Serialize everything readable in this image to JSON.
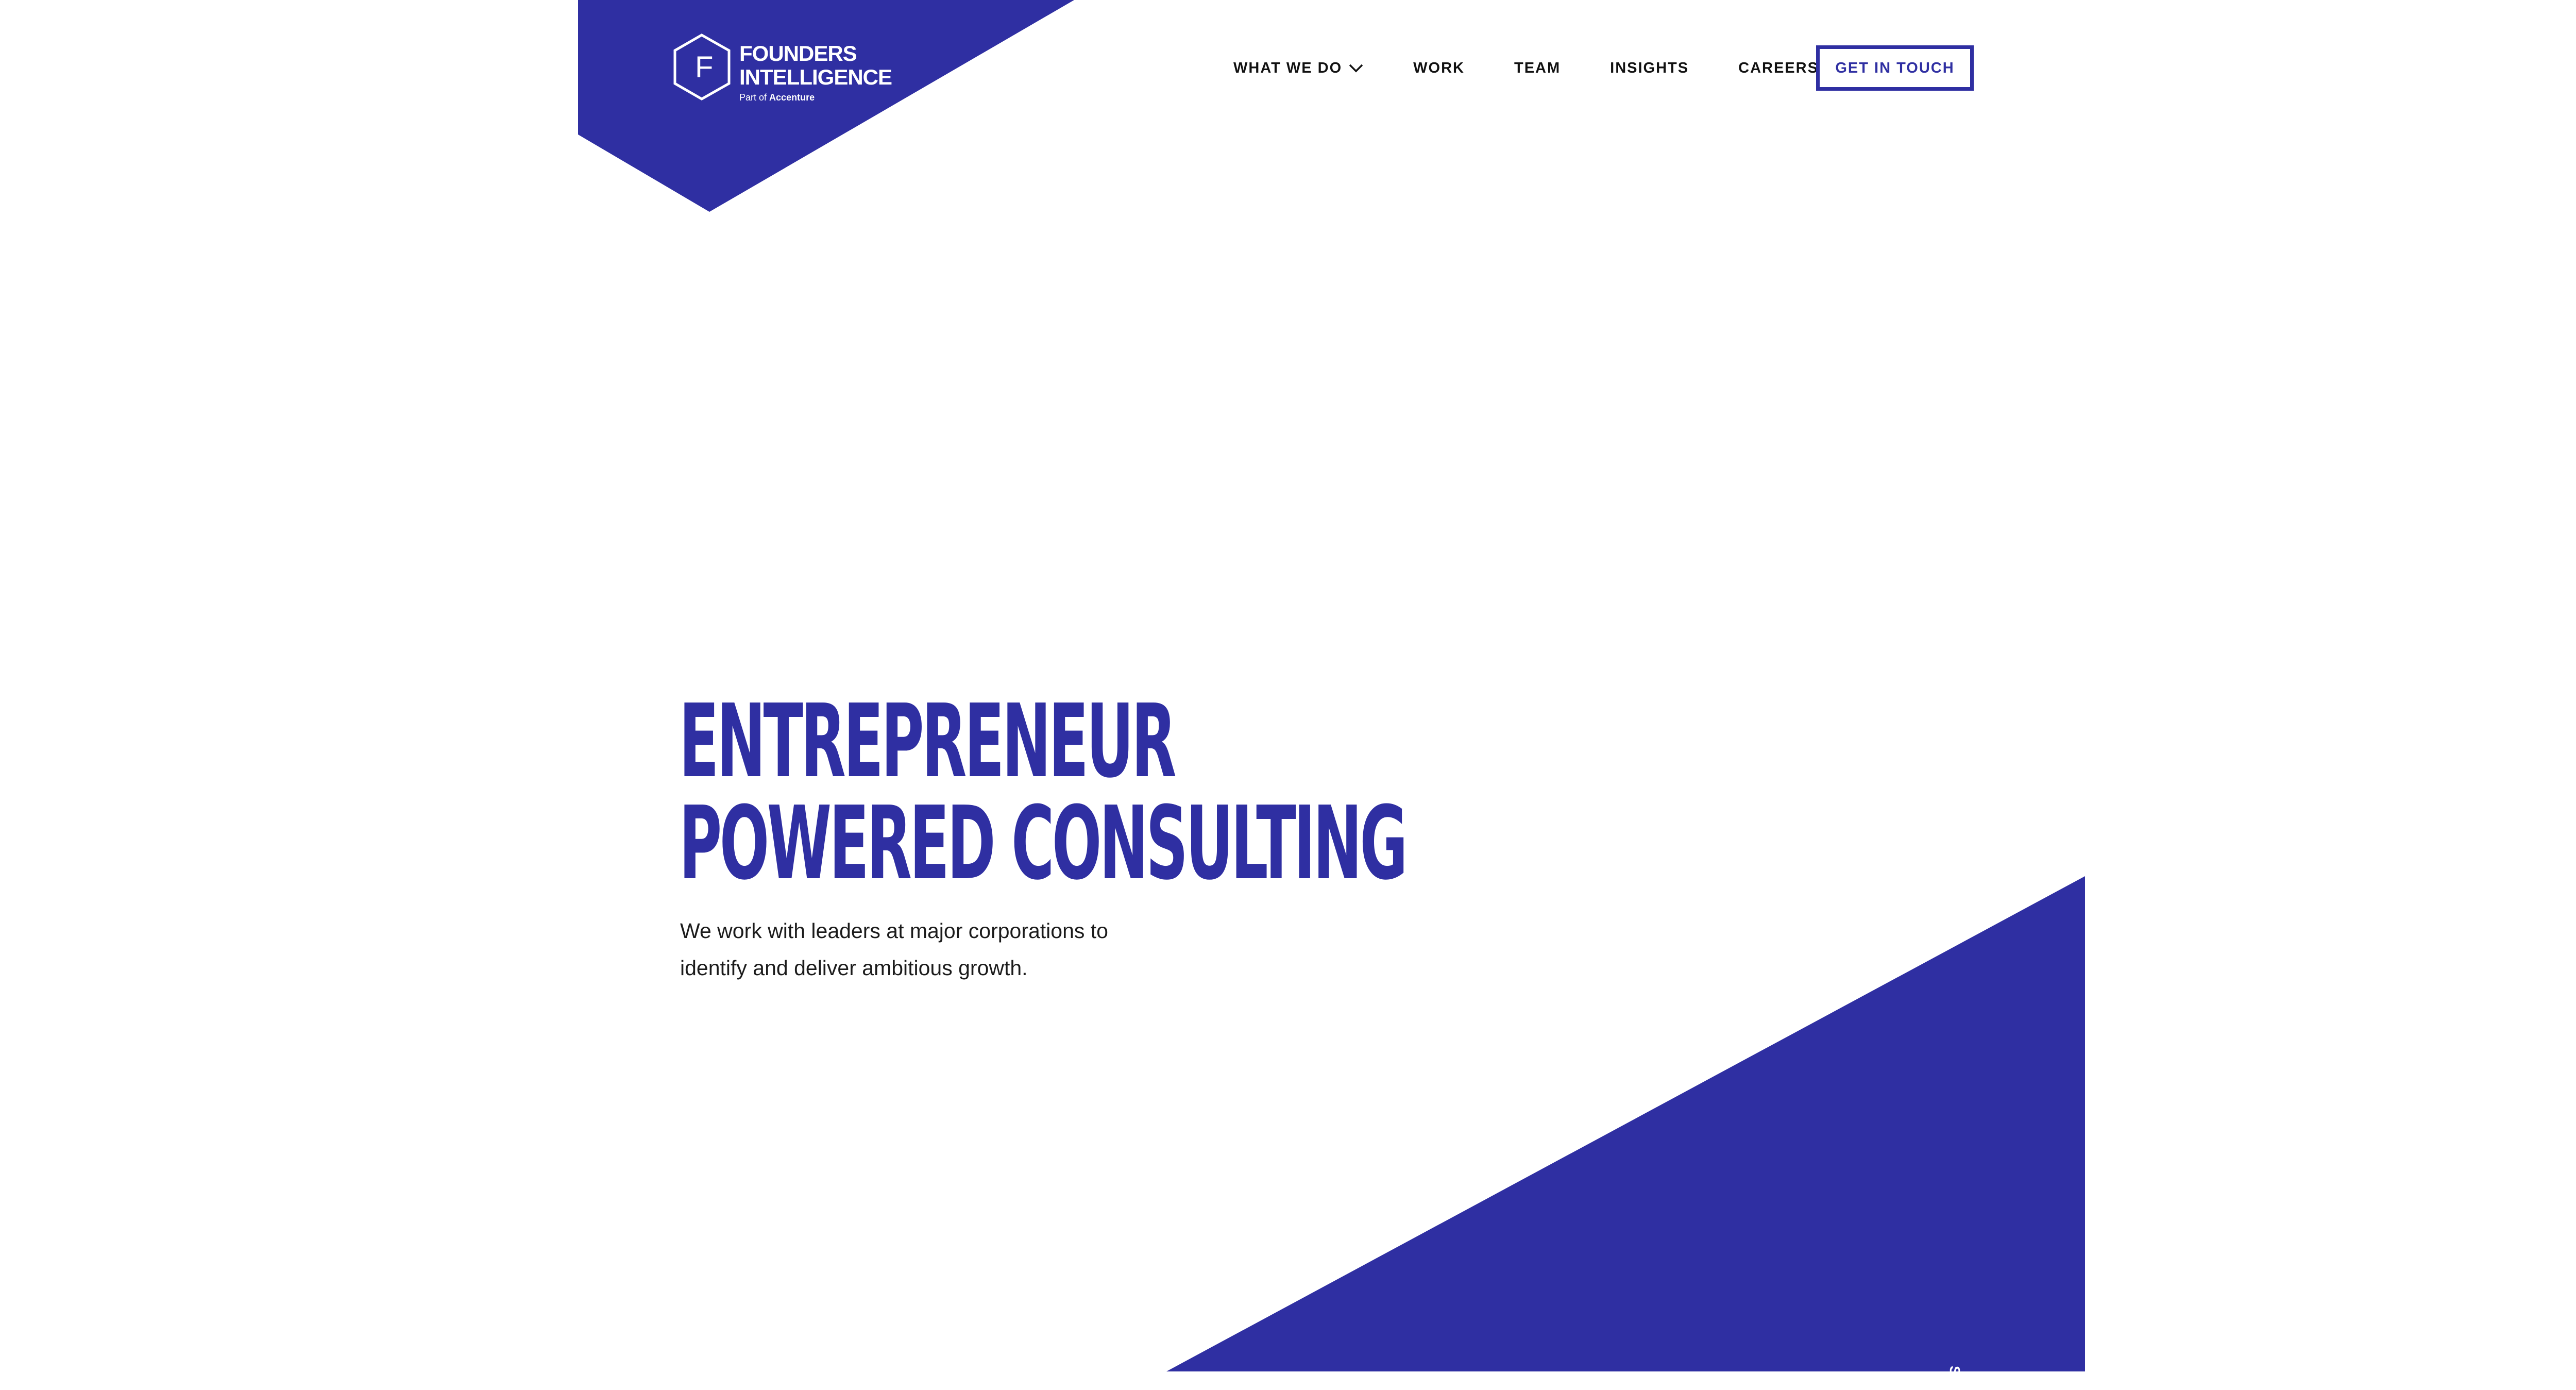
{
  "brand": {
    "name_line_1": "FOUNDERS",
    "name_line_2": "INTELLIGENCE",
    "subtitle_prefix": "Part of",
    "subtitle_name": "Accenture",
    "logo_mark": "F",
    "logo_icon": "hexagon-f-icon",
    "color": "#2f2fa2"
  },
  "nav": {
    "items": [
      {
        "label": "WHAT WE DO",
        "icon": "chevron-down-icon"
      },
      {
        "label": "WORK"
      },
      {
        "label": "TEAM"
      },
      {
        "label": "INSIGHTS"
      },
      {
        "label": "CAREERS"
      }
    ],
    "cta_label": "GET IN TOUCH"
  },
  "hero": {
    "title_line_1": "ENTREPRENEUR",
    "title_line_2": "POWERED CONSULTING",
    "body_line_1": "We work with leaders at major corporations to",
    "body_line_2": "identify and deliver ambitious growth."
  },
  "decor": {
    "scroll_hint": "SC"
  }
}
